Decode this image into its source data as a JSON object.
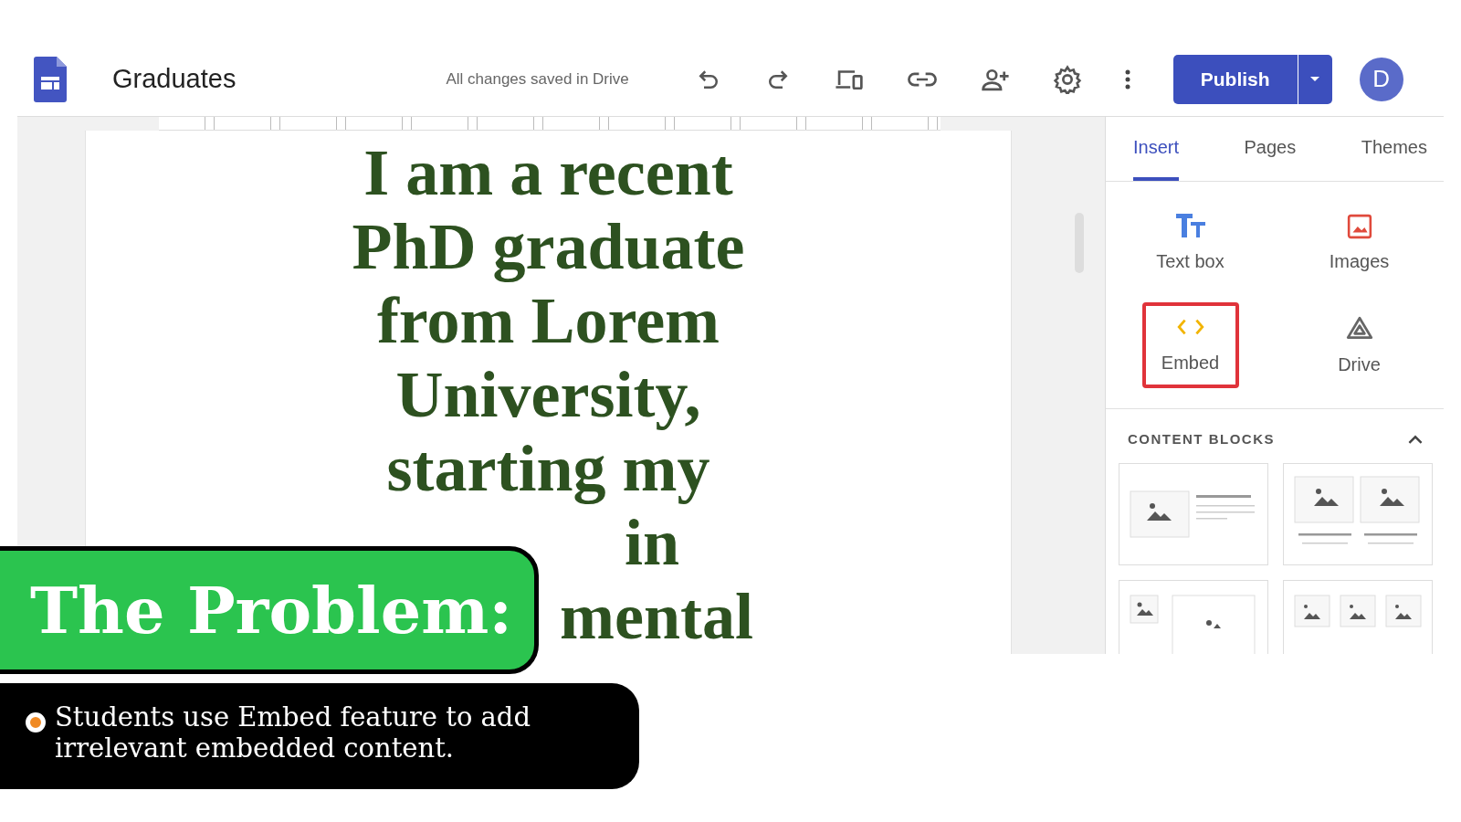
{
  "app": {
    "title": "Graduates",
    "save_status": "All changes saved in Drive",
    "publish_button": "Publish",
    "avatar": "D"
  },
  "page": {
    "heading_lines": [
      "I am a recent",
      "PhD graduate",
      "from Lorem",
      "University,",
      "starting my",
      "in",
      "mental"
    ]
  },
  "panel": {
    "tabs": [
      {
        "label": "Insert",
        "selected": true
      },
      {
        "label": "Pages",
        "selected": false
      },
      {
        "label": "Themes",
        "selected": false
      }
    ],
    "insert_items": [
      {
        "label": "Text box",
        "kind": "textbox",
        "highlighted": false
      },
      {
        "label": "Images",
        "kind": "images",
        "highlighted": false
      },
      {
        "label": "Embed",
        "kind": "embed",
        "highlighted": true
      },
      {
        "label": "Drive",
        "kind": "drive",
        "highlighted": false
      }
    ],
    "section_title": "CONTENT BLOCKS",
    "section_expanded": true
  },
  "slide": {
    "title": "The Problem:",
    "bullets": [
      "Students use Embed feature to add irrelevant embedded content."
    ]
  }
}
